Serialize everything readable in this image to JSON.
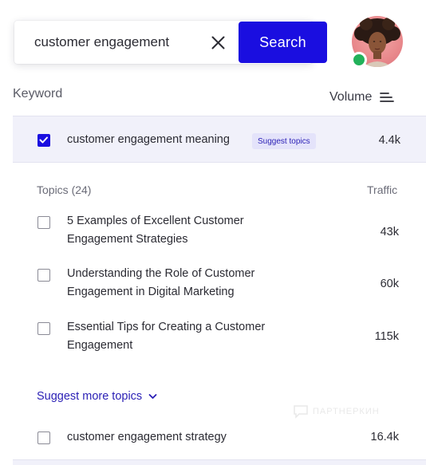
{
  "search": {
    "value": "customer engagement",
    "button_label": "Search"
  },
  "table": {
    "keyword_header": "Keyword",
    "volume_header": "Volume",
    "selected": {
      "keyword": "customer engagement meaning",
      "badge": "Suggest topics",
      "volume": "4.4k",
      "checked": true
    },
    "topics_header": "Topics (24)",
    "traffic_header": "Traffic",
    "topics": [
      {
        "line1": "5 Examples of Excellent Customer",
        "line2": "Engagement Strategies",
        "traffic": "43k"
      },
      {
        "line1": "Understanding the Role of Customer",
        "line2": "Engagement in Digital Marketing",
        "traffic": "60k"
      },
      {
        "line1": "Essential Tips for Creating a Customer",
        "line2": "Engagement",
        "traffic": "115k"
      }
    ],
    "suggest_more": "Suggest more topics",
    "next_keyword": {
      "keyword": "customer engagement strategy",
      "volume": "16.4k"
    }
  },
  "watermark": "ПАРТНЕРКИН",
  "colors": {
    "primary": "#1a0ee0",
    "selected_bg": "#f1f1fa",
    "badge_bg": "#e4e3fa",
    "status_online": "#22b15a"
  },
  "icons": [
    "close-icon",
    "sort-icon",
    "check-icon",
    "chevron-down-icon"
  ]
}
